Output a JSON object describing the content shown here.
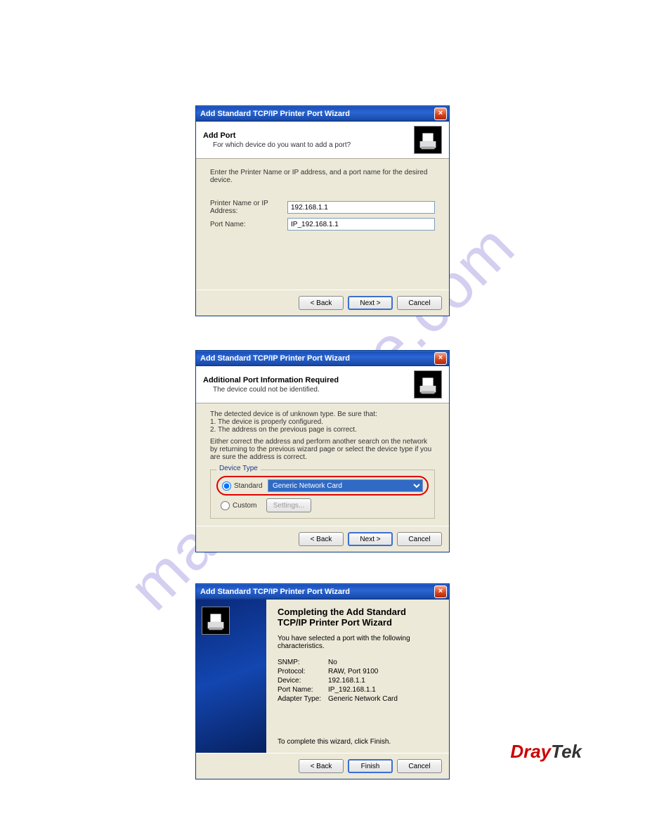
{
  "watermark": "manualshive.com",
  "dialog1": {
    "title": "Add Standard TCP/IP Printer Port Wizard",
    "heading": "Add Port",
    "subheading": "For which device do you want to add a port?",
    "instruction": "Enter the Printer Name or IP address, and a port name for the desired device.",
    "field1_label": "Printer Name or IP Address:",
    "field1_value": "192.168.1.1",
    "field2_label": "Port Name:",
    "field2_value": "IP_192.168.1.1",
    "back": "< Back",
    "next": "Next >",
    "cancel": "Cancel"
  },
  "dialog2": {
    "title": "Add Standard TCP/IP Printer Port Wizard",
    "heading": "Additional Port Information Required",
    "subheading": "The device could not be identified.",
    "para1": "The detected device is of unknown type.  Be sure that:",
    "bullet1": "1. The device is properly configured.",
    "bullet2": "2. The address on the previous page is correct.",
    "para2": "Either correct the address and perform another search on the network by returning to the previous wizard page or select the device type if you are sure the address is correct.",
    "group_label": "Device Type",
    "radio_standard": "Standard",
    "select_value": "Generic Network Card",
    "radio_custom": "Custom",
    "settings_btn": "Settings...",
    "back": "< Back",
    "next": "Next >",
    "cancel": "Cancel"
  },
  "dialog3": {
    "title": "Add Standard TCP/IP Printer Port Wizard",
    "heading": "Completing the Add Standard TCP/IP Printer Port Wizard",
    "intro": "You have selected a port with the following characteristics.",
    "rows": {
      "snmp_k": "SNMP:",
      "snmp_v": "No",
      "proto_k": "Protocol:",
      "proto_v": "RAW, Port 9100",
      "dev_k": "Device:",
      "dev_v": "192.168.1.1",
      "port_k": "Port Name:",
      "port_v": "IP_192.168.1.1",
      "adap_k": "Adapter Type:",
      "adap_v": "Generic Network Card"
    },
    "footer": "To complete this wizard, click Finish.",
    "back": "< Back",
    "finish": "Finish",
    "cancel": "Cancel"
  },
  "brand": {
    "d": "Dray",
    "rest": "Tek"
  }
}
